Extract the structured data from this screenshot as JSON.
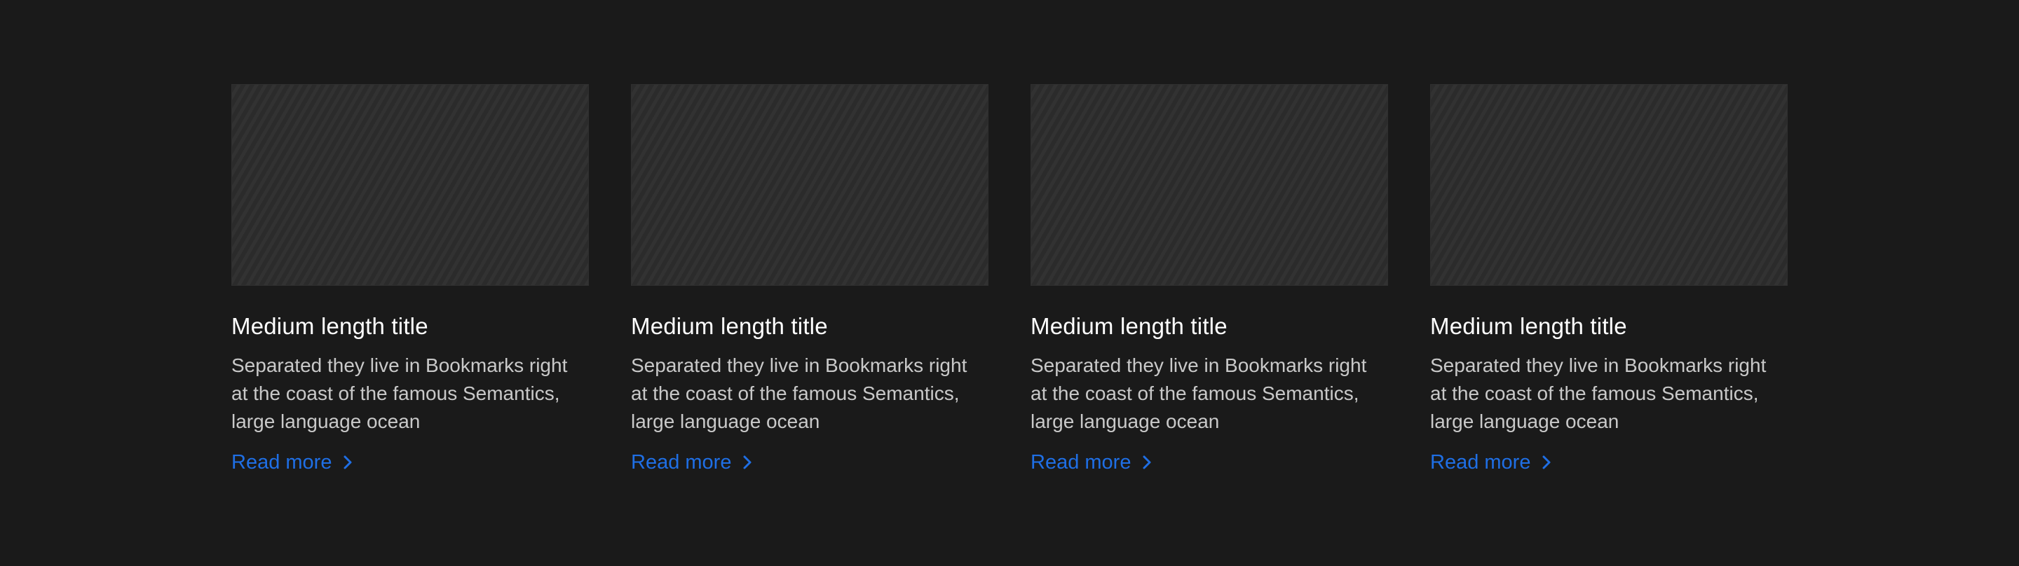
{
  "colors": {
    "background": "#1a1a1a",
    "title": "#ffffff",
    "body_text": "#c9c9c9",
    "link": "#1f6fe5",
    "thumbnail": "#2b2b2b"
  },
  "cards": [
    {
      "title": "Medium length title",
      "description": "Separated they live in Bookmarks right at the coast of the famous Semantics, large language ocean",
      "link_label": "Read more",
      "link_icon": "chevron-right-icon"
    },
    {
      "title": "Medium length title",
      "description": "Separated they live in Bookmarks right at the coast of the famous Semantics, large language ocean",
      "link_label": "Read more",
      "link_icon": "chevron-right-icon"
    },
    {
      "title": "Medium length title",
      "description": "Separated they live in Bookmarks right at the coast of the famous Semantics, large language ocean",
      "link_label": "Read more",
      "link_icon": "chevron-right-icon"
    },
    {
      "title": "Medium length title",
      "description": "Separated they live in Bookmarks right at the coast of the famous Semantics, large language ocean",
      "link_label": "Read more",
      "link_icon": "chevron-right-icon"
    }
  ]
}
